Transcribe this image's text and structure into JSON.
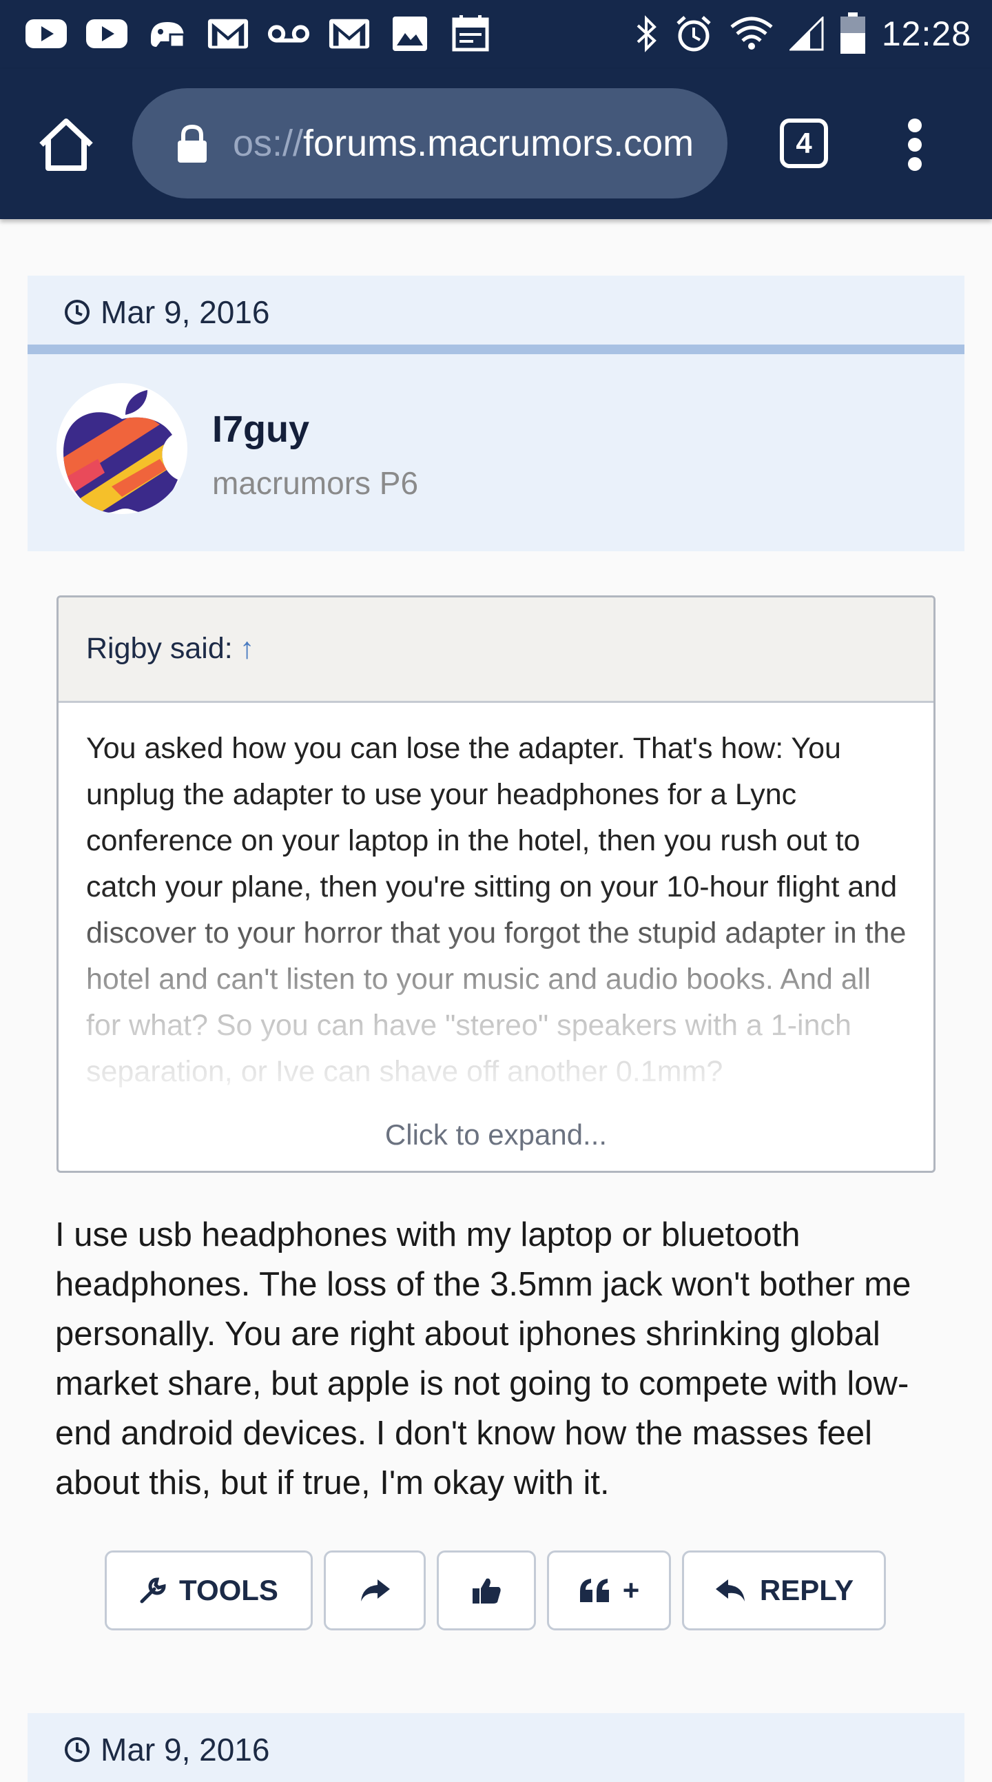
{
  "status_bar": {
    "time": "12:28",
    "left_icons": [
      "youtube-icon",
      "youtube-icon",
      "game-controller-icon",
      "gmail-icon",
      "voicemail-icon",
      "gmail-icon",
      "image-icon",
      "calendar-icon"
    ],
    "right_icons": [
      "bluetooth-icon",
      "alarm-icon",
      "wifi-icon",
      "signal-icon",
      "battery-icon"
    ]
  },
  "browser": {
    "url_prefix": "os://",
    "url_domain": "forums.macrumors.com",
    "tab_count": "4"
  },
  "post": {
    "date": "Mar 9, 2016",
    "username": "I7guy",
    "user_title": "macrumors P6",
    "quote": {
      "attribution": "Rigby said:",
      "arrow": "↑",
      "text": "You asked how you can lose the adapter. That's how: You unplug the adapter to use your headphones for a Lync conference on your laptop in the hotel, then you rush out to catch your plane, then you're sitting on your 10-hour flight and discover to your horror that you forgot the stupid adapter in the hotel and can't listen to your music and audio books. And all for what? So you can have \"stereo\" speakers with a 1-inch separation, or Ive can shave off another 0.1mm?",
      "expand_label": "Click to expand..."
    },
    "message": "I use usb headphones with my laptop or bluetooth headphones. The loss of the 3.5mm jack won't bother me personally. You are right about iphones shrinking global market share, but apple is not going to compete with low-end android devices. I don't know how the masses feel about this, but if true, I'm okay with it.",
    "actions": {
      "tools_label": "TOOLS",
      "multiquote_label": "+",
      "reply_label": "REPLY"
    }
  },
  "next_post": {
    "date": "Mar 9, 2016"
  },
  "colors": {
    "header_bg": "#15284b",
    "urlbar_bg": "#44587a",
    "post_header_bg": "#eaf1fa",
    "accent_border": "#a8c1e3"
  }
}
